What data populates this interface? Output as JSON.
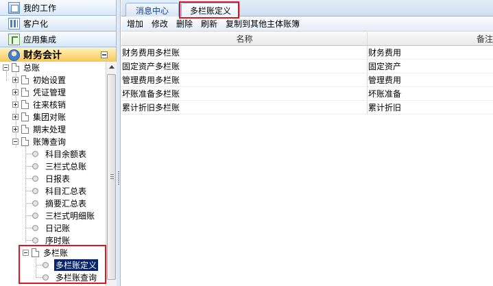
{
  "sidebar": {
    "nav": [
      {
        "label": "我的工作",
        "icon": "work-icon"
      },
      {
        "label": "客户化",
        "icon": "customize-icon"
      },
      {
        "label": "应用集成",
        "icon": "integration-icon"
      },
      {
        "label": "财务会计",
        "icon": "finance-icon",
        "active": true
      }
    ]
  },
  "tree": {
    "root": "总账",
    "groups": [
      "初始设置",
      "凭证管理",
      "往来核销",
      "集团对账",
      "期末处理",
      "账簿查询"
    ],
    "ledger_items": [
      "科目余额表",
      "三栏式总账",
      "日报表",
      "科目汇总表",
      "摘要汇总表",
      "三栏式明细账",
      "日记账",
      "序时账"
    ],
    "multi": "多栏账",
    "multi_items": [
      "多栏账定义",
      "多栏账查询"
    ],
    "selected": "多栏账定义"
  },
  "tabs": [
    {
      "label": "消息中心",
      "active": false
    },
    {
      "label": "多栏账定义",
      "active": true
    }
  ],
  "toolbar": {
    "add": "增加",
    "edit": "修改",
    "delete": "删除",
    "refresh": "刷新",
    "copy": "复制到其他主体账簿"
  },
  "grid": {
    "columns": [
      "名称",
      "备注"
    ],
    "rows": [
      [
        "财务费用多栏账",
        "财务费用"
      ],
      [
        "固定资产多栏账",
        "固定资产"
      ],
      [
        "管理费用多栏账",
        "管理费用"
      ],
      [
        "坏账准备多栏账",
        "坏账准备"
      ],
      [
        "累计折旧多栏账",
        "累计折旧"
      ]
    ]
  },
  "colors": {
    "accent": "#99bbe8",
    "active_nav": "#f9c64d",
    "selection": "#0a246a",
    "annotation": "#e0141c"
  }
}
